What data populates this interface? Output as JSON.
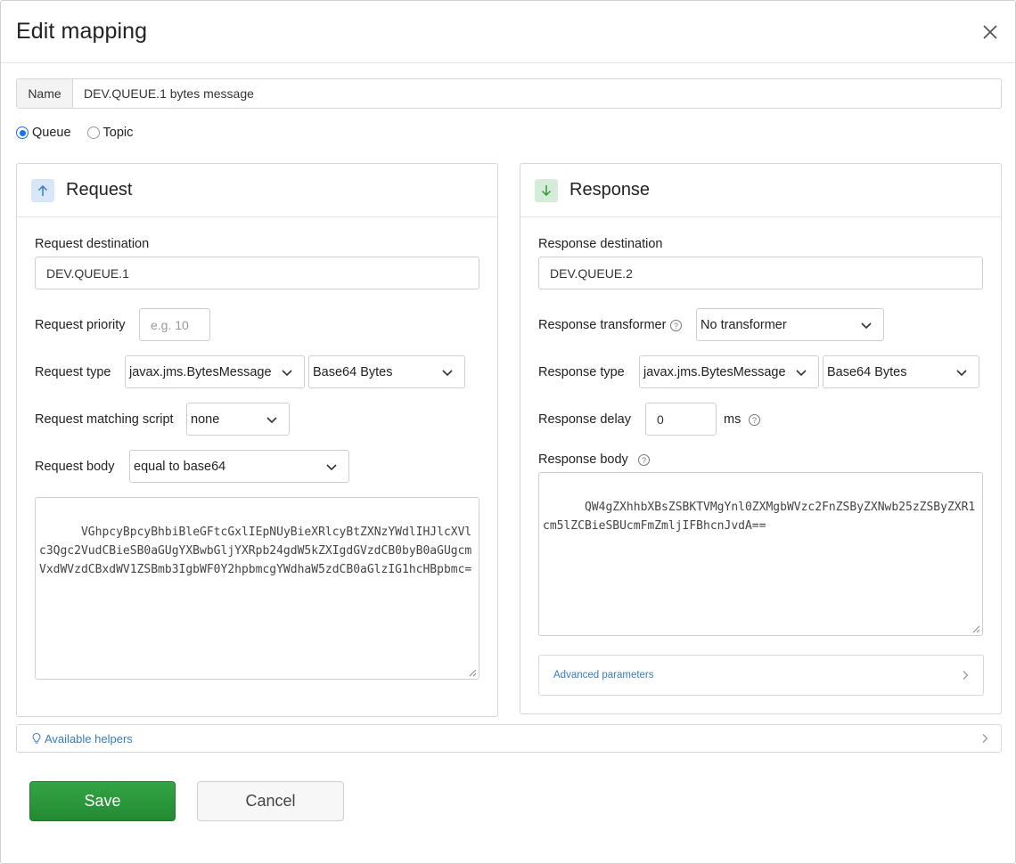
{
  "dialog": {
    "title": "Edit mapping",
    "close_icon": "close-icon"
  },
  "name_field": {
    "label": "Name",
    "value": "DEV.QUEUE.1 bytes message"
  },
  "destination_kind": {
    "options": [
      {
        "label": "Queue",
        "checked": true
      },
      {
        "label": "Topic",
        "checked": false
      }
    ]
  },
  "request": {
    "title": "Request",
    "icon": "arrow-up-icon",
    "destination_label": "Request destination",
    "destination_value": "DEV.QUEUE.1",
    "priority_label": "Request priority",
    "priority_placeholder": "e.g. 10",
    "type_label": "Request type",
    "type_value": "javax.jms.BytesMessage",
    "encoding_value": "Base64 Bytes",
    "matching_script_label": "Request matching script",
    "matching_script_value": "none",
    "body_label": "Request body",
    "body_operator": "equal to base64",
    "body_value": "VGhpcyBpcyBhbiBleGFtcGxlIEpNUyBieXRlcyBtZXNzYWdlIHJlcXVlc3Qgc2VudCBieSB0aGUgYXBwbGljYXRpb24gdW5kZXIgdGVzdCB0byB0aGUgcmVxdWVzdCBxdWV1ZSBmb3IgbWF0Y2hpbmcgYWdhaW5zdCB0aGlzIG1hcHBpbmc="
  },
  "response": {
    "title": "Response",
    "icon": "arrow-down-icon",
    "destination_label": "Response destination",
    "destination_value": "DEV.QUEUE.2",
    "transformer_label": "Response transformer",
    "transformer_value": "No transformer",
    "type_label": "Response type",
    "type_value": "javax.jms.BytesMessage",
    "encoding_value": "Base64 Bytes",
    "delay_label": "Response delay",
    "delay_value": "0",
    "delay_unit": "ms",
    "body_label": "Response body",
    "body_value": "QW4gZXhhbXBsZSBKTVMgYnl0ZXMgbWVzc2FnZSByZXNwb25zZSByZXR1cm5lZCBieSBUcmFmZmljIFBhcnJvdA==",
    "advanced_label": "Advanced parameters"
  },
  "helpers": {
    "label": "Available helpers",
    "icon": "lightbulb-icon"
  },
  "actions": {
    "save_label": "Save",
    "cancel_label": "Cancel"
  },
  "colors": {
    "primary_green": "#2e9a3e",
    "link_blue": "#3a7bbf",
    "radio_blue": "#1a73e8"
  }
}
